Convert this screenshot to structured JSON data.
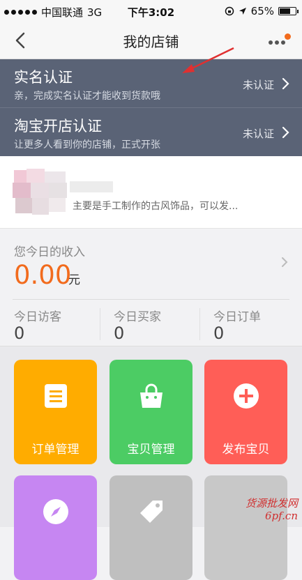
{
  "status_bar": {
    "carrier": "中国联通",
    "network": "3G",
    "time": "下午3:02",
    "battery": "65%"
  },
  "nav": {
    "title": "我的店铺",
    "back_icon": "chevron-left-icon",
    "more_icon": "more-dots-icon",
    "badge_color": "#f26b1d"
  },
  "auth_items": [
    {
      "title": "实名认证",
      "subtitle": "亲，完成实名认证才能收到货款哦",
      "status": "未认证"
    },
    {
      "title": "淘宝开店认证",
      "subtitle": "让更多人看到你的店铺，正式开张",
      "status": "未认证"
    }
  ],
  "shop": {
    "description": "主要是手工制作的古风饰品，可以发..."
  },
  "income": {
    "label": "您今日的收入",
    "value": "0.00",
    "unit": "元"
  },
  "stats": [
    {
      "label": "今日访客",
      "value": "0"
    },
    {
      "label": "今日买家",
      "value": "0"
    },
    {
      "label": "今日订单",
      "value": "0"
    }
  ],
  "tiles": [
    {
      "label": "订单管理",
      "icon": "order-list-icon",
      "color": "#ffac00"
    },
    {
      "label": "宝贝管理",
      "icon": "shopping-bag-icon",
      "color": "#4ccc64"
    },
    {
      "label": "发布宝贝",
      "icon": "plus-circle-icon",
      "color": "#ff5e57"
    },
    {
      "label": "",
      "icon": "compass-icon",
      "color": "#c686f2"
    },
    {
      "label": "",
      "icon": "tag-icon",
      "color": "#bfbfbf"
    },
    {
      "label": "",
      "icon": "",
      "color": "#c8c8c8"
    }
  ],
  "watermark": {
    "line1": "货源批发网",
    "line2": "6pf.cn"
  },
  "colors": {
    "accent": "#f26b1d",
    "auth_bg": "#5a6376"
  }
}
